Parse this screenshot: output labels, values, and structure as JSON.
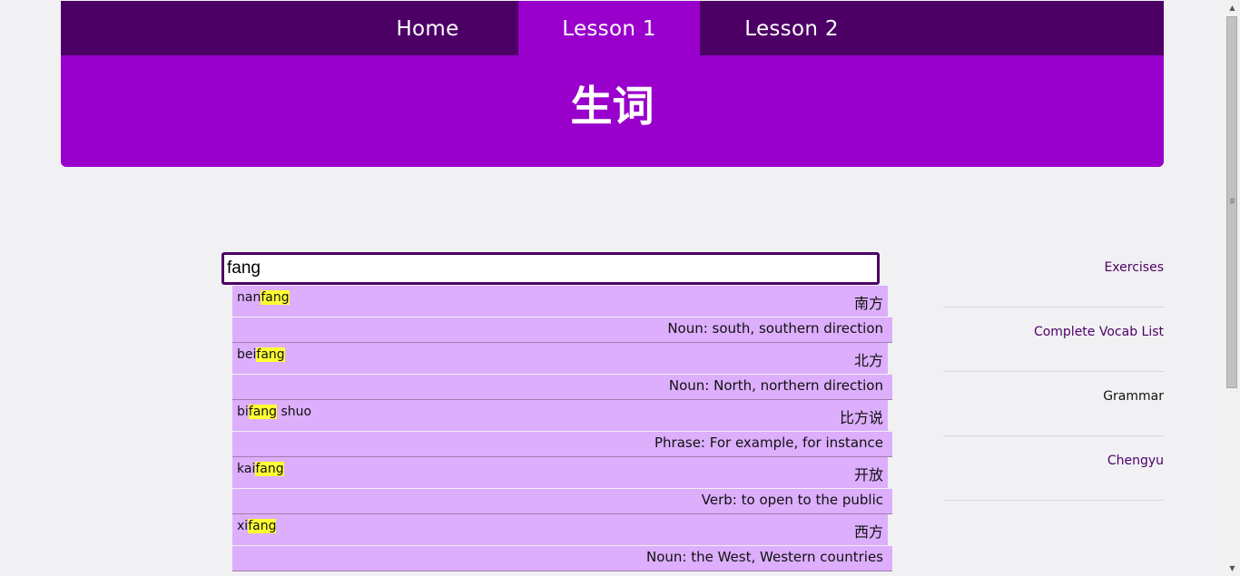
{
  "nav": {
    "items": [
      {
        "label": "Home"
      },
      {
        "label": "Lesson 1"
      },
      {
        "label": "Lesson 2"
      }
    ]
  },
  "header": {
    "title": "生词"
  },
  "search": {
    "value": "fang"
  },
  "results": [
    {
      "pinyin_pre": "nan",
      "pinyin_match": "fang",
      "pinyin_post": "",
      "hanzi": "南方",
      "meaning": "Noun: south, southern direction"
    },
    {
      "pinyin_pre": "bei",
      "pinyin_match": "fang",
      "pinyin_post": "",
      "hanzi": "北方",
      "meaning": "Noun: North, northern direction"
    },
    {
      "pinyin_pre": "bi",
      "pinyin_match": "fang",
      "pinyin_post": " shuo",
      "hanzi": "比方说",
      "meaning": "Phrase: For example, for instance"
    },
    {
      "pinyin_pre": "kai",
      "pinyin_match": "fang",
      "pinyin_post": "",
      "hanzi": "开放",
      "meaning": "Verb: to open to the public"
    },
    {
      "pinyin_pre": "xi",
      "pinyin_match": "fang",
      "pinyin_post": "",
      "hanzi": "西方",
      "meaning": "Noun: the West, Western countries"
    }
  ],
  "side_nav": {
    "items": [
      {
        "label": "Exercises"
      },
      {
        "label": "Complete Vocab List"
      },
      {
        "label": "Grammar"
      },
      {
        "label": "Chengyu"
      }
    ]
  },
  "colors": {
    "nav_bg": "#4c0066",
    "header_bg": "#9900cc",
    "result_bg": "#dcaefc",
    "highlight": "#ffff33"
  }
}
